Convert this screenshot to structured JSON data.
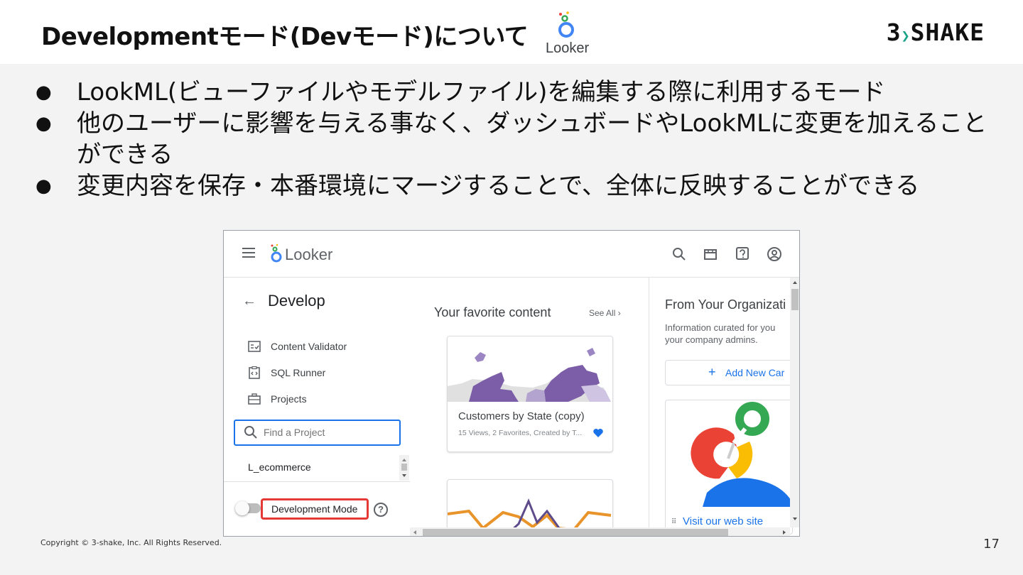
{
  "slide": {
    "title": "Developmentモード(Devモード)について",
    "header_logo_text": "Looker",
    "brand": {
      "left": "3",
      "right": "SHAKE"
    },
    "bullets": [
      "LookML(ビューファイルやモデルファイル)を編集する際に利用するモード",
      "他のユーザーに影響を与える事なく、ダッシュボードやLookMLに変更を加えることができる",
      "変更内容を保存・本番環境にマージすることで、全体に反映することができる"
    ],
    "copyright": "Copyright © 3-shake, Inc. All Rights Reserved.",
    "page_number": "17"
  },
  "screenshot": {
    "app_name": "Looker",
    "top_icons": [
      "search-icon",
      "store-icon",
      "help-icon",
      "account-icon"
    ],
    "develop": {
      "title": "Develop",
      "menu": [
        {
          "label": "Content Validator",
          "icon": "checklist-icon"
        },
        {
          "label": "SQL Runner",
          "icon": "code-icon"
        },
        {
          "label": "Projects",
          "icon": "briefcase-icon"
        }
      ],
      "search_placeholder": "Find a Project",
      "project": "L_ecommerce",
      "dev_mode_label": "Development Mode",
      "dev_mode_on": false
    },
    "favorites": {
      "title": "Your favorite content",
      "see_all": "See All ›",
      "cards": [
        {
          "title": "Customers by State (copy)",
          "meta": "15 Views, 2 Favorites, Created by T..."
        }
      ]
    },
    "organization": {
      "title": "From Your Organizati",
      "description": "Information curated for you your company admins.",
      "add_button": "Add New Car",
      "visit_link": "Visit our web site"
    },
    "colors": {
      "accent": "#1a73e8",
      "highlight": "#e53935",
      "map_purple": "#7b5ea7",
      "chart_orange": "#e8942a"
    }
  }
}
